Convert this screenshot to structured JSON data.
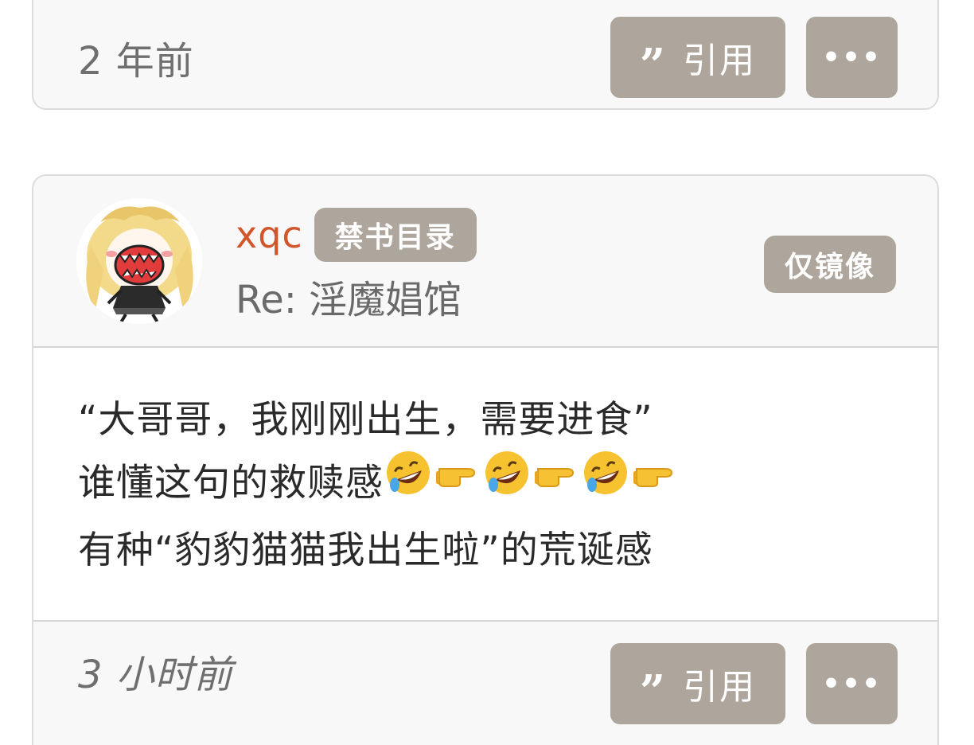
{
  "previous_post": {
    "timestamp": "2 年前",
    "quote_label": "引用",
    "more_label": "•••"
  },
  "post": {
    "username": "xqc",
    "user_tag": "禁书目录",
    "subject": "Re: 淫魔娼馆",
    "mirror_badge": "仅镜像",
    "body": {
      "line1": "“大哥哥，我刚刚出生，需要进食”",
      "line2_text": "谁懂这句的救赎感",
      "line2_emojis": [
        "rolling-laughing-emoji",
        "pointing-right-emoji",
        "rolling-laughing-emoji",
        "pointing-right-emoji",
        "rolling-laughing-emoji",
        "pointing-right-emoji"
      ],
      "line3": "有种“豹豹猫猫我出生啦”的荒诞感"
    },
    "timestamp": "3 小时前",
    "quote_label": "引用",
    "more_label": "•••"
  },
  "colors": {
    "button_bg": "#aea69c",
    "username": "#d2562a",
    "card_bg": "#f8f8f8",
    "border": "#dcdcdc"
  }
}
